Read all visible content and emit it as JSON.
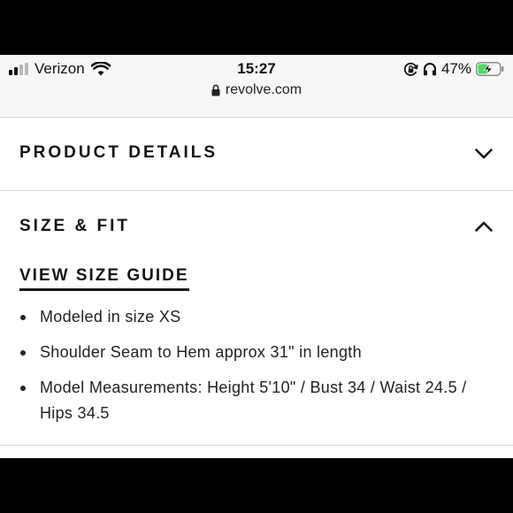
{
  "status_bar": {
    "carrier": "Verizon",
    "time": "15:27",
    "battery_percent": "47%",
    "battery_level": 0.47,
    "charging": true,
    "battery_color": "#4cd964"
  },
  "browser": {
    "url": "revolve.com",
    "lock_icon": "lock-icon"
  },
  "sections": {
    "product_details": {
      "title": "PRODUCT DETAILS",
      "expanded": false,
      "icon": "chevron-down-icon"
    },
    "size_fit": {
      "title": "SIZE & FIT",
      "expanded": true,
      "icon": "chevron-up-icon",
      "size_guide_link": "VIEW SIZE GUIDE",
      "bullets": [
        "Modeled in size XS",
        "Shoulder Seam to Hem approx 31\" in length",
        "Model Measurements: Height 5'10\" / Bust 34 / Waist 24.5 / Hips 34.5"
      ]
    }
  }
}
